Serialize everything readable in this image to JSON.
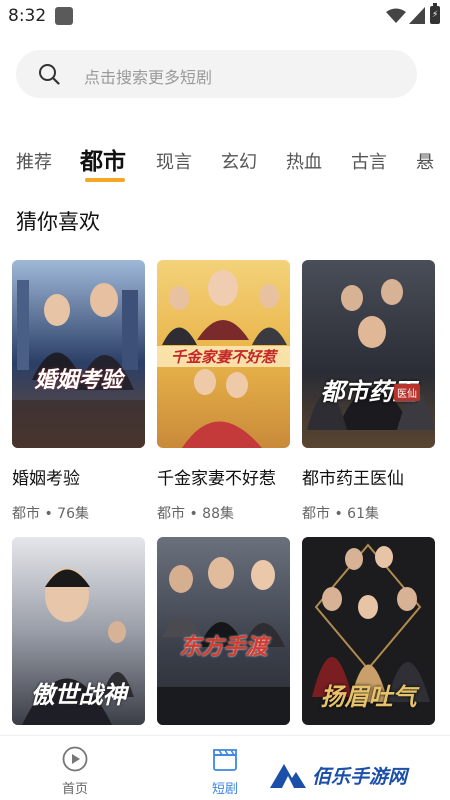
{
  "status_bar": {
    "time": "8:32",
    "battery_label": "⚡"
  },
  "search": {
    "placeholder": "点击搜索更多短剧"
  },
  "tabs": [
    {
      "label": "推荐",
      "active": false
    },
    {
      "label": "都市",
      "active": true
    },
    {
      "label": "现言",
      "active": false
    },
    {
      "label": "玄幻",
      "active": false
    },
    {
      "label": "热血",
      "active": false
    },
    {
      "label": "古言",
      "active": false
    },
    {
      "label": "悬",
      "active": false
    }
  ],
  "accent_color": "#f5a623",
  "section": {
    "title": "猜你喜欢"
  },
  "cards": [
    {
      "title": "婚姻考验",
      "genre": "都市",
      "episodes": "76集",
      "meta": "都市 • 76集",
      "poster_text": "婚姻考验",
      "poster_palette": [
        "#2b3f66",
        "#9e7a56"
      ]
    },
    {
      "title": "千金家妻不好惹",
      "genre": "都市",
      "episodes": "88集",
      "meta": "都市 • 88集",
      "poster_text": "千金家妻不好惹",
      "poster_palette": [
        "#e9b54a",
        "#c4393a"
      ]
    },
    {
      "title": "都市药王医仙",
      "genre": "都市",
      "episodes": "61集",
      "meta": "都市 • 61集",
      "poster_text": "都市药王",
      "poster_badge": "医仙",
      "poster_palette": [
        "#2a2d35",
        "#7a5c3a"
      ]
    },
    {
      "title": "",
      "meta": "",
      "poster_text": "傲世战神",
      "poster_palette": [
        "#cfd3db",
        "#3b3e47"
      ]
    },
    {
      "title": "",
      "meta": "",
      "poster_text": "东方手渡",
      "poster_palette": [
        "#3a3f4a",
        "#c9b79a"
      ]
    },
    {
      "title": "",
      "meta": "",
      "poster_text": "扬眉吐气",
      "poster_palette": [
        "#1c1c1f",
        "#b08c4e"
      ]
    }
  ],
  "bottom_nav": [
    {
      "label": "首页",
      "icon": "play-circle-icon",
      "active": false
    },
    {
      "label": "短剧",
      "icon": "clapperboard-icon",
      "active": true
    }
  ],
  "watermark": {
    "text": "佰乐手游网"
  }
}
